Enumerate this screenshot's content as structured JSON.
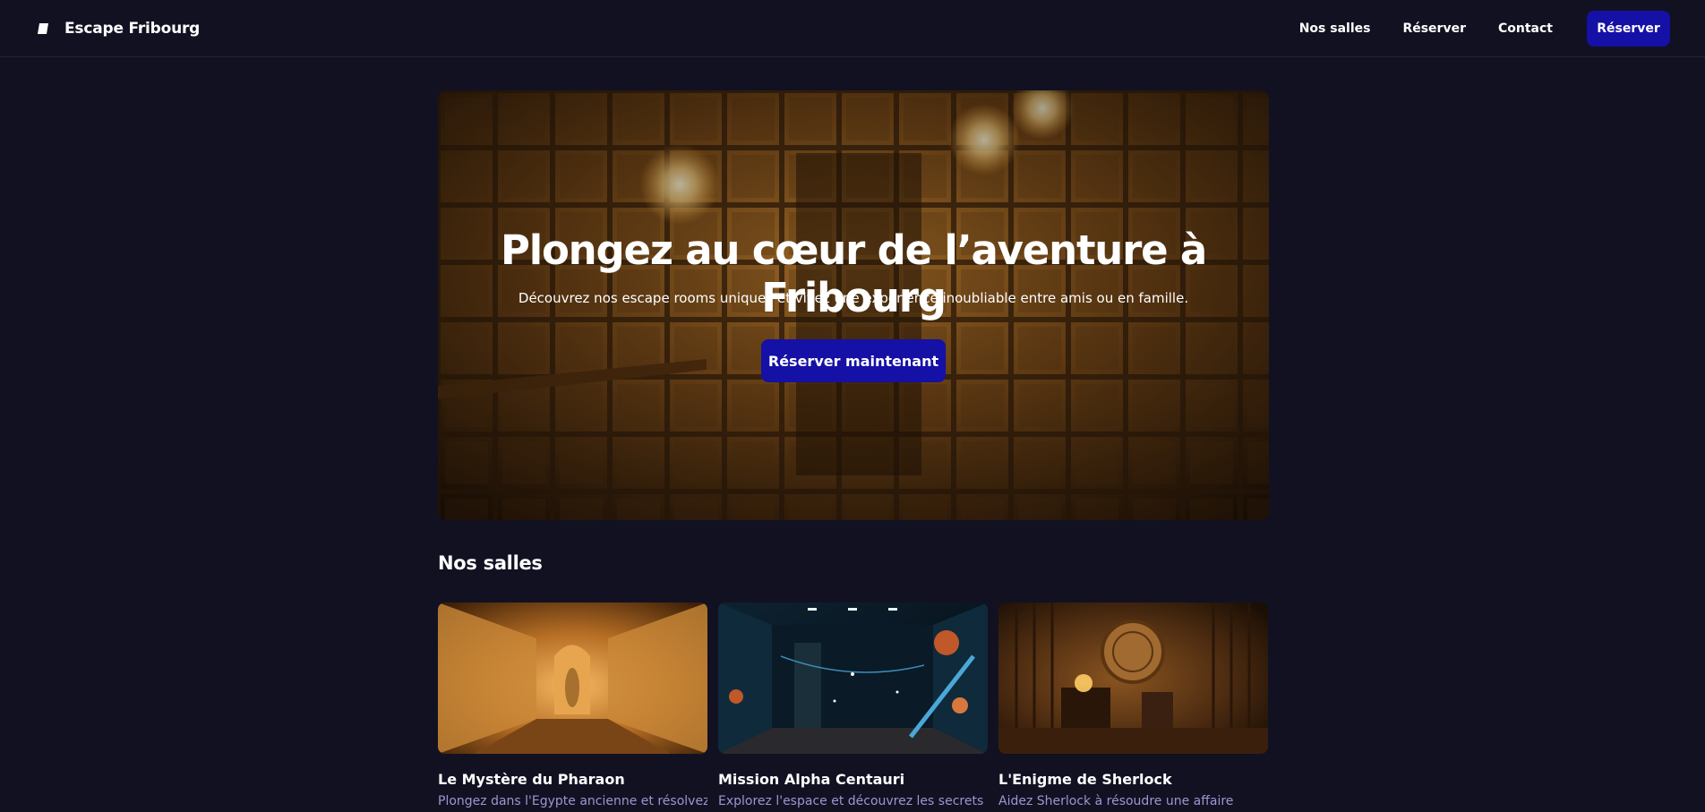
{
  "header": {
    "brand": "Escape Fribourg",
    "nav": [
      "Nos salles",
      "Réserver",
      "Contact"
    ],
    "cta": "Réserver"
  },
  "hero": {
    "title": "Plongez au cœur de l’aventure à Fribourg",
    "subtitle": "Découvrez nos escape rooms uniques et vivez une expérience inoubliable entre amis ou en famille.",
    "cta": "Réserver maintenant"
  },
  "rooms": {
    "title": "Nos salles",
    "items": [
      {
        "title": "Le Mystère du Pharaon",
        "desc": "Plongez dans l'Egypte ancienne et résolvez"
      },
      {
        "title": "Mission Alpha Centauri",
        "desc": "Explorez l'espace et découvrez les secrets"
      },
      {
        "title": "L'Enigme de Sherlock",
        "desc": "Aidez Sherlock à résoudre une affaire"
      }
    ]
  },
  "colors": {
    "background": "#121122",
    "accent": "#1510a6",
    "muted_text": "#9a97d0"
  },
  "icons": {
    "brand": "brand-logo-icon"
  }
}
